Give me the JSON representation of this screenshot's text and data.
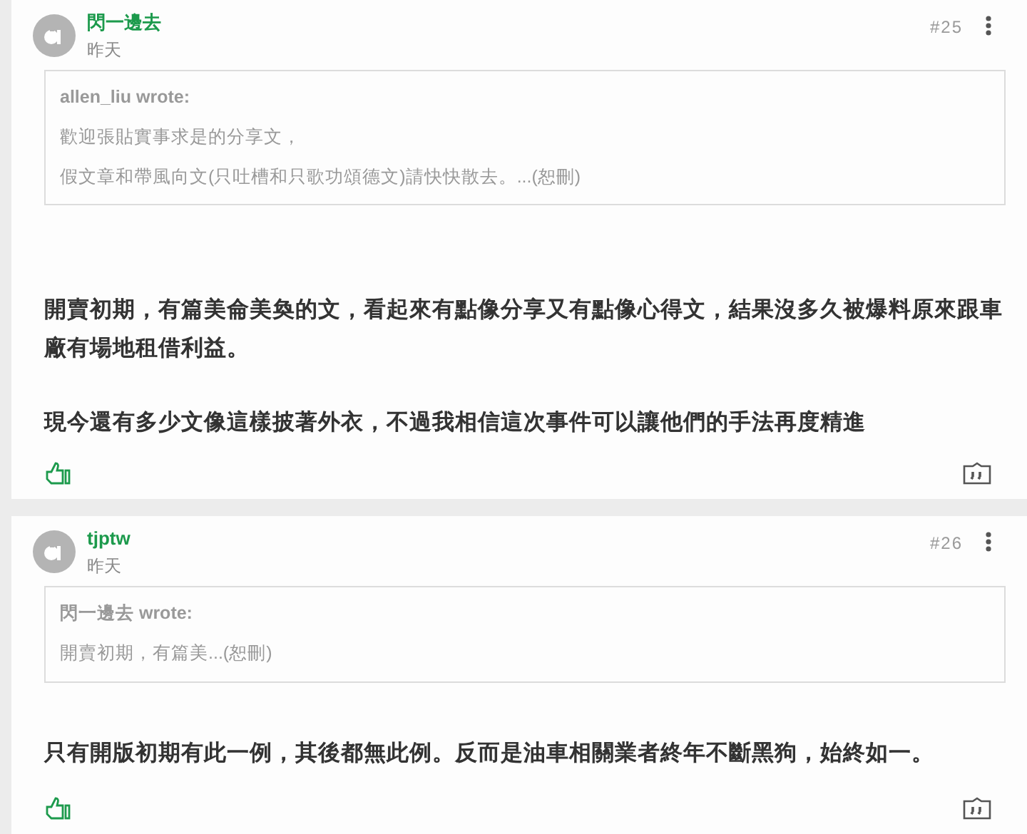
{
  "posts": [
    {
      "author": "閃一邊去",
      "date": "昨天",
      "number": "#25",
      "quote": {
        "header": "allen_liu wrote:",
        "lines": [
          "歡迎張貼實事求是的分享文，",
          "假文章和帶風向文(只吐槽和只歌功頌德文)請快快散去。...(恕刪)"
        ]
      },
      "paragraphs": [
        "開賣初期，有篇美侖美奐的文，看起來有點像分享又有點像心得文，結果沒多久被爆料原來跟車廠有場地租借利益。",
        "現今還有多少文像這樣披著外衣，不過我相信這次事件可以讓他們的手法再度精進"
      ]
    },
    {
      "author": "tjptw",
      "date": "昨天",
      "number": "#26",
      "quote": {
        "header": "閃一邊去 wrote:",
        "lines": [
          "開賣初期，有篇美...(恕刪)"
        ]
      },
      "paragraphs": [
        "只有開版初期有此一例，其後都無此例。反而是油車相關業者終年不斷黑狗，始終如一。"
      ]
    }
  ]
}
